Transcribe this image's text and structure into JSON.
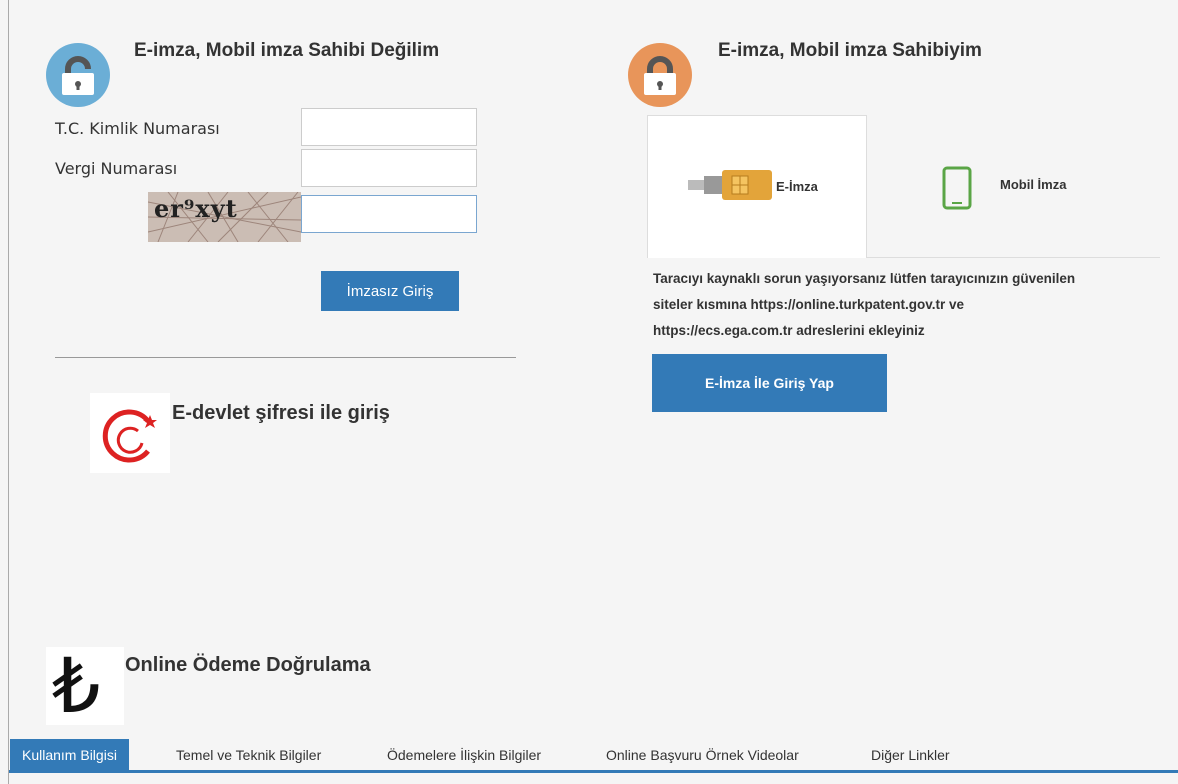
{
  "left_panel": {
    "title": "E-imza, Mobil imza Sahibi Değilim",
    "lock_color": "#6baed6",
    "tc_label": "T.C. Kimlik Numarası",
    "tc_value": "",
    "vergi_label": "Vergi Numarası",
    "vergi_value": "",
    "captcha_text": "er⁹xyt",
    "captcha_value": "",
    "submit_label": "İmzasız Giriş"
  },
  "edevlet": {
    "label": "E-devlet şifresi ile giriş"
  },
  "right_panel": {
    "title": "E-imza, Mobil imza Sahibiyim",
    "lock_color": "#e8955a",
    "tabs": [
      {
        "label": "E-İmza",
        "icon": "smart-card-icon",
        "active": true
      },
      {
        "label": "Mobil İmza",
        "icon": "mobile-phone-icon",
        "active": false
      }
    ],
    "info_lines": [
      "Taracıyı kaynaklı sorun yaşıyorsanız lütfen tarayıcınızın güvenilen",
      "siteler kısmına https://online.turkpatent.gov.tr ve",
      "https://ecs.ega.com.tr adreslerini ekleyiniz"
    ],
    "submit_label": "E-İmza İle Giriş Yap"
  },
  "payment": {
    "symbol": "₺",
    "label": "Online Ödeme Doğrulama"
  },
  "bottom_tabs": [
    {
      "label": "Kullanım Bilgisi",
      "active": true
    },
    {
      "label": "Temel ve Teknik Bilgiler",
      "active": false
    },
    {
      "label": "Ödemelere İlişkin Bilgiler",
      "active": false
    },
    {
      "label": "Online Başvuru Örnek Videolar",
      "active": false
    },
    {
      "label": "Diğer Linkler",
      "active": false
    }
  ],
  "colors": {
    "accent": "#337ab7",
    "mobile_icon": "#5aa546"
  }
}
